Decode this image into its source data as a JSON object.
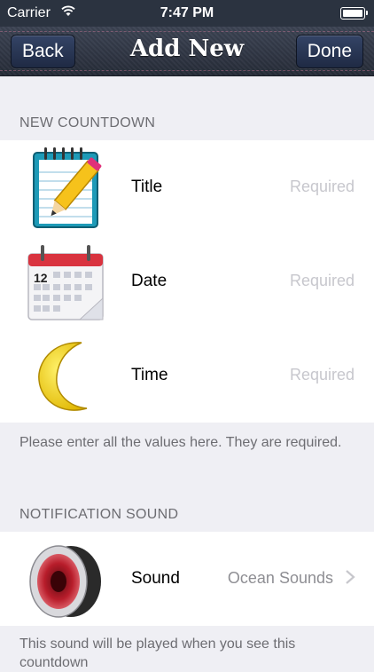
{
  "status_bar": {
    "carrier": "Carrier",
    "time": "7:47 PM"
  },
  "nav": {
    "back_label": "Back",
    "title": "Add New",
    "done_label": "Done"
  },
  "sections": {
    "new_countdown": {
      "header": "NEW COUNTDOWN",
      "rows": [
        {
          "label": "Title",
          "placeholder": "Required",
          "icon": "notepad-pencil-icon"
        },
        {
          "label": "Date",
          "placeholder": "Required",
          "icon": "calendar-icon"
        },
        {
          "label": "Time",
          "placeholder": "Required",
          "icon": "moon-icon"
        }
      ],
      "footer": "Please enter all the values here. They are required."
    },
    "notification_sound": {
      "header": "NOTIFICATION SOUND",
      "rows": [
        {
          "label": "Sound",
          "value": "Ocean Sounds",
          "icon": "speaker-icon"
        }
      ],
      "footer": "This sound will be played when you see this countdown"
    }
  },
  "colors": {
    "nav_background": "#2b3340",
    "group_background": "#efeff4",
    "placeholder": "#c7c7cd",
    "section_text": "#6d6d72"
  }
}
